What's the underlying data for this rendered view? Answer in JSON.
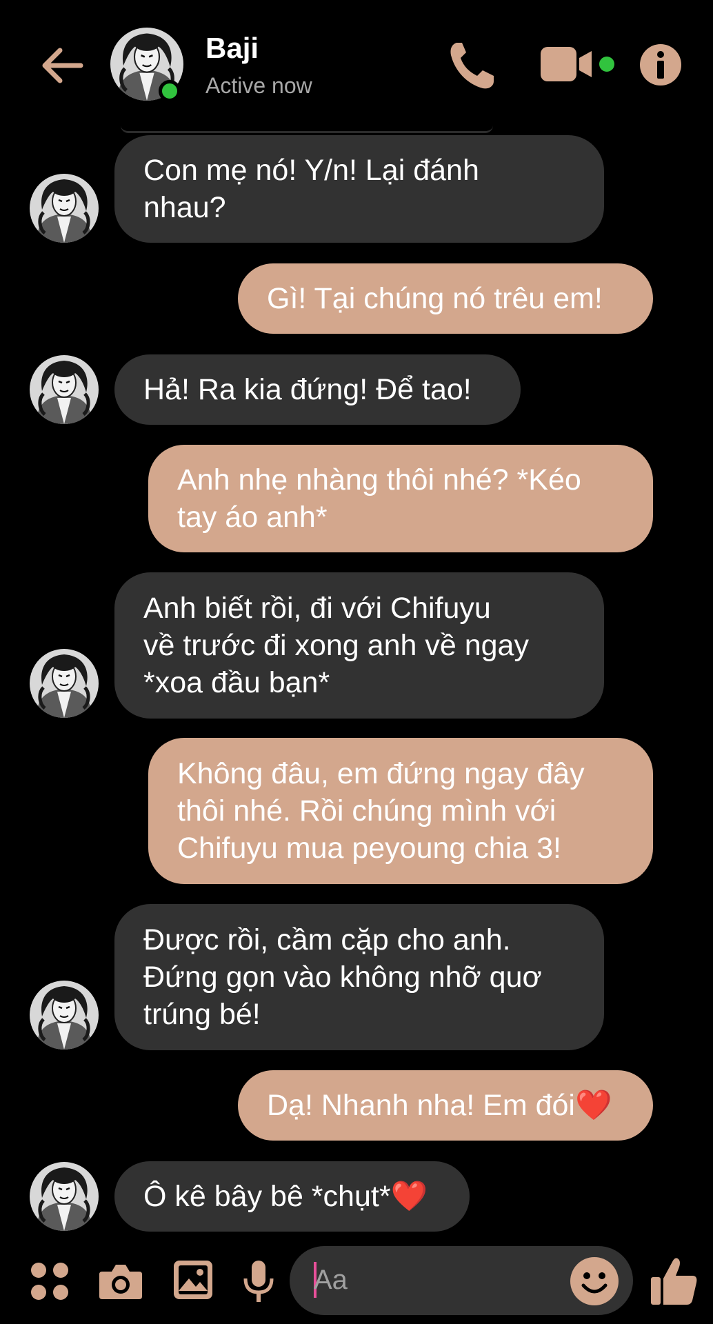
{
  "header": {
    "name": "Baji",
    "status": "Active now"
  },
  "messages": [
    {
      "side": "received",
      "text": "Con mẹ nó! Y/n! Lại đánh\nnhau?"
    },
    {
      "side": "sent",
      "text": "Gì! Tại chúng nó trêu em!"
    },
    {
      "side": "received",
      "text": "Hả! Ra kia đứng! Để tao!"
    },
    {
      "side": "sent",
      "text": "Anh nhẹ nhàng thôi nhé? *Kéo\ntay áo anh*"
    },
    {
      "side": "received",
      "text": "Anh biết rồi, đi với Chifuyu\nvề trước đi xong anh về ngay\n*xoa đầu bạn*"
    },
    {
      "side": "sent",
      "text": "Không đâu, em đứng ngay đây\nthôi nhé. Rồi chúng mình với\nChifuyu mua peyoung chia 3!"
    },
    {
      "side": "received",
      "text": "Được rồi, cầm cặp cho anh.\nĐứng gọn vào không nhỡ quơ\ntrúng bé!"
    },
    {
      "side": "sent",
      "text": "Dạ! Nhanh nha! Em đói",
      "emoji": "❤️"
    },
    {
      "side": "received",
      "text": "Ô kê bây bê *chụt*",
      "emoji": "❤️"
    }
  ],
  "composer": {
    "placeholder": "Aa"
  },
  "icons": {
    "back": "back-arrow-icon",
    "call": "phone-icon",
    "video": "video-camera-icon",
    "info": "info-icon",
    "apps": "four-dots-icon",
    "camera": "camera-icon",
    "gallery": "image-icon",
    "mic": "microphone-icon",
    "emoji": "smiley-icon",
    "like": "thumbs-up-icon"
  },
  "colors": {
    "accent": "#d3a78d",
    "received_bubble": "#323232",
    "online": "#31c33e"
  }
}
